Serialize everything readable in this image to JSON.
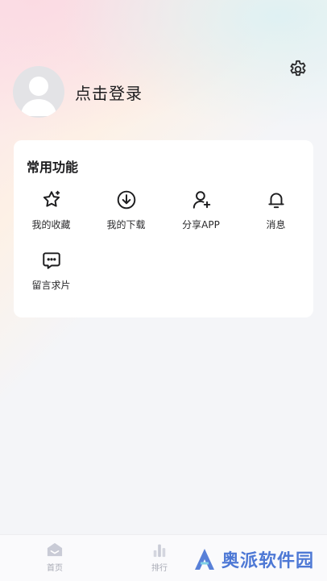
{
  "profile": {
    "login_label": "点击登录"
  },
  "functions": {
    "title": "常用功能",
    "items": [
      {
        "label": "我的收藏",
        "icon": "star-icon"
      },
      {
        "label": "我的下载",
        "icon": "download-icon"
      },
      {
        "label": "分享APP",
        "icon": "add-user-icon"
      },
      {
        "label": "消息",
        "icon": "bell-icon"
      },
      {
        "label": "留言求片",
        "icon": "message-icon"
      }
    ]
  },
  "tabbar": {
    "tabs": [
      {
        "label": "首页",
        "icon": "home-icon"
      },
      {
        "label": "排行",
        "icon": "ranking-icon"
      }
    ]
  },
  "watermark": {
    "text": "奥派软件园"
  },
  "colors": {
    "accent": "#3b6ad1",
    "text": "#1c1c1e",
    "muted": "#a7a9b4"
  }
}
